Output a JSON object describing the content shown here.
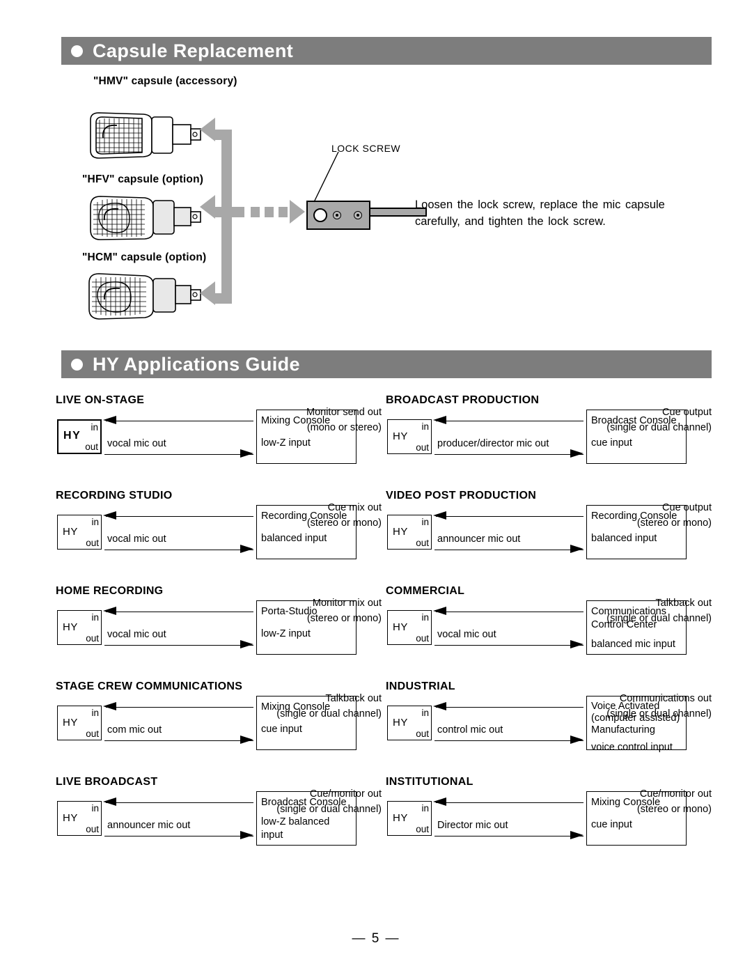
{
  "page": {
    "footer": "— 5 —"
  },
  "sections": [
    {
      "id": "capsule-replacement",
      "title": "Capsule Replacement",
      "bullet": "filled-circle-bullet"
    },
    {
      "id": "hy-applications-guide",
      "title": "HY Applications Guide",
      "bullet": "filled-circle-bullet"
    }
  ],
  "capsule_replacement": {
    "capsules": [
      {
        "label": "\"HMV\"  capsule  (accessory)"
      },
      {
        "label": "\"HFV\"  capsule  (option)"
      },
      {
        "label": "\"HCM\"  capsule  (option)"
      }
    ],
    "lock_screw_label": "LOCK  SCREW",
    "instruction": "Loosen the lock screw, replace the mic capsule carefully, and tighten the lock screw."
  },
  "applications": {
    "hy_box": {
      "name": "HY",
      "in": "in",
      "out": "out"
    },
    "items": [
      {
        "title": "LIVE  ON-STAGE",
        "top_label": "Monitor send out",
        "sub_label": "(mono or stereo)",
        "bottom_label": "vocal  mic out",
        "dest_lines": [
          "Mixing Console",
          "low-Z input"
        ],
        "dest_style": "gap",
        "hy_bold": true
      },
      {
        "title": "BROADCAST  PRODUCTION",
        "top_label": "Cue output",
        "sub_label": "(single or dual channel)",
        "bottom_label": "producer/director  mic out",
        "dest_lines": [
          "Broadcast Console",
          "cue input"
        ],
        "dest_style": "gap",
        "hy_bold": false
      },
      {
        "title": "RECORDING  STUDIO",
        "top_label": "Cue  mix out",
        "sub_label": "(stereo or mono)",
        "bottom_label": "vocal  mic out",
        "dest_lines": [
          "Recording Console",
          "balanced input"
        ],
        "dest_style": "gap",
        "hy_bold": false
      },
      {
        "title": "VIDEO  POST  PRODUCTION",
        "top_label": "Cue output",
        "sub_label": "(stereo or mono)",
        "bottom_label": "announcer  mic out",
        "dest_lines": [
          "Recording Console",
          "balanced input"
        ],
        "dest_style": "gap",
        "hy_bold": false
      },
      {
        "title": "HOME  RECORDING",
        "top_label": "Monitor mix out",
        "sub_label": "(stereo or mono)",
        "bottom_label": "vocal  mic out",
        "dest_lines": [
          "Porta-Studio",
          "low-Z input"
        ],
        "dest_style": "gap",
        "hy_bold": false
      },
      {
        "title": "COMMERCIAL",
        "top_label": "Talkback out",
        "sub_label": "(single or dual channel)",
        "bottom_label": "vocal  mic out",
        "dest_lines": [
          "Communications",
          "Control Center",
          "balanced mic input"
        ],
        "dest_style": "gap-last",
        "hy_bold": false
      },
      {
        "title": "STAGE  CREW  COMMUNICATIONS",
        "top_label": "Talkback out",
        "sub_label": "(single or dual channel)",
        "bottom_label": "com  mic out",
        "dest_lines": [
          "Mixing Console",
          "cue input"
        ],
        "dest_style": "gap",
        "hy_bold": false
      },
      {
        "title": "INDUSTRIAL",
        "top_label": "Communications out",
        "sub_label": "(single or dual channel)",
        "bottom_label": "control  mic out",
        "dest_lines": [
          "Voice Activated",
          "(computer assisted)",
          "Manufacturing",
          "voice control input"
        ],
        "dest_style": "tight-last",
        "hy_bold": false
      },
      {
        "title": "LIVE  BROADCAST",
        "top_label": "Cue/monitor out",
        "sub_label": "(single or dual channel)",
        "bottom_label": "announcer  mic out",
        "dest_lines": [
          "Broadcast Console",
          "low-Z balanced",
          "input"
        ],
        "dest_style": "gap-mid",
        "hy_bold": false
      },
      {
        "title": "INSTITUTIONAL",
        "top_label": "Cue/monitor out",
        "sub_label": "(stereo or mono)",
        "bottom_label": "Director  mic out",
        "dest_lines": [
          "Mixing Console",
          "cue input"
        ],
        "dest_style": "gap",
        "hy_bold": false
      }
    ]
  }
}
